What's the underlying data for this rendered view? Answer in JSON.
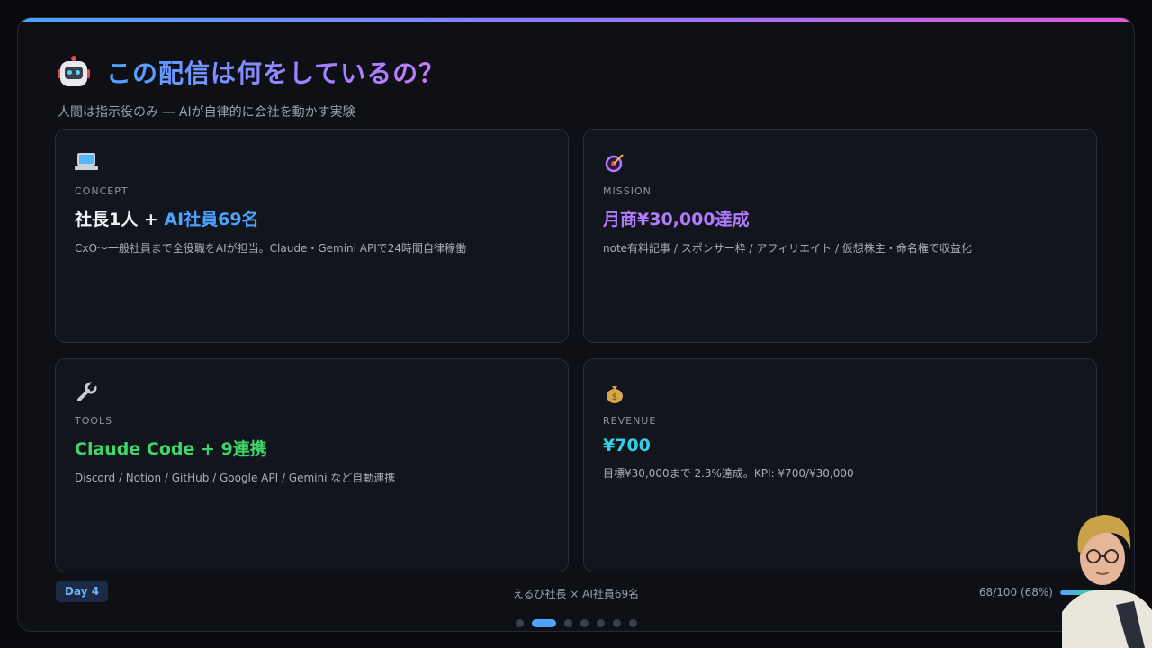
{
  "header": {
    "title": "この配信は何をしているの？",
    "subtitle": "人間は指示役のみ ― AIが自律的に会社を動かす実験",
    "icon": "robot-icon"
  },
  "cards": [
    {
      "icon": "laptop-icon",
      "label": "CONCEPT",
      "headline_a": "社長1人 + ",
      "headline_b": "AI社員69名",
      "headline_b_color": "#4ea3ff",
      "desc": "CxO〜一般社員まで全役職をAIが担当。Claude・Gemini APIで24時間自律稼働"
    },
    {
      "icon": "target-icon",
      "label": "MISSION",
      "headline": "月商¥30,000達成",
      "headline_color": "#b07cff",
      "desc": "note有料記事 / スポンサー枠 / アフィリエイト / 仮想株主・命名権で収益化"
    },
    {
      "icon": "wrench-icon",
      "label": "TOOLS",
      "headline": "Claude Code + 9連携",
      "headline_color": "#3fd66a",
      "desc": "Discord / Notion / GitHub / Google API / Gemini など自動連携"
    },
    {
      "icon": "money-bag-icon",
      "label": "REVENUE",
      "headline": "¥700",
      "headline_color": "#33d0e8",
      "desc": "目標¥30,000まで 2.3%達成。KPI: ¥700/¥30,000"
    }
  ],
  "footer": {
    "badge": "Day 4",
    "center": "えるび社長 × AI社員69名",
    "progress_text": "68/100 (68%)",
    "progress_value": 0.68
  },
  "pagination": {
    "count": 7,
    "active_index": 1
  },
  "colors": {
    "accent": "#4ea3ff",
    "gradient_end": "#e25ad8"
  }
}
